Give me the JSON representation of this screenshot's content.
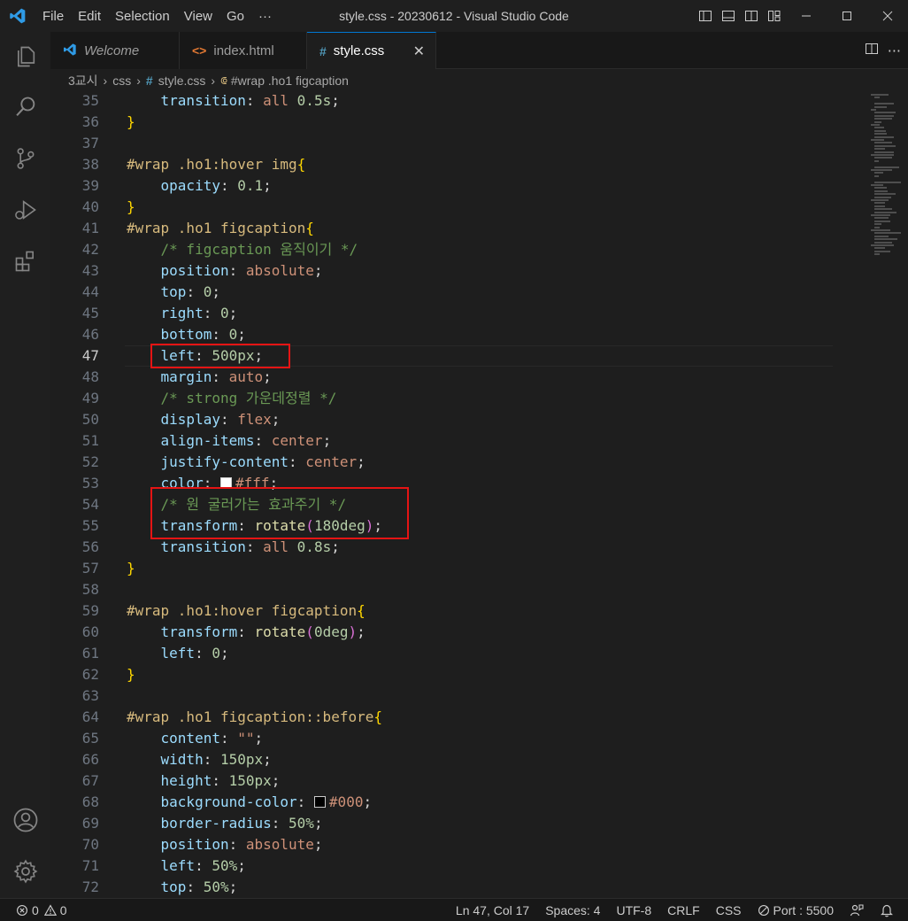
{
  "menu": [
    "File",
    "Edit",
    "Selection",
    "View",
    "Go",
    "···"
  ],
  "window_title": "style.css - 20230612 - Visual Studio Code",
  "tabs": [
    {
      "label": "Welcome",
      "icon": "vscode-icon"
    },
    {
      "label": "index.html",
      "icon": "html-icon"
    },
    {
      "label": "style.css",
      "icon": "css-icon",
      "active": true
    }
  ],
  "breadcrumb": [
    "3교시",
    "css",
    "style.css",
    "#wrap .ho1 figcaption"
  ],
  "code_lines": [
    {
      "n": "35",
      "text": "    transition: all 0.5s;"
    },
    {
      "n": "36",
      "text": "}"
    },
    {
      "n": "37",
      "text": ""
    },
    {
      "n": "38",
      "text": "#wrap .ho1:hover img{"
    },
    {
      "n": "39",
      "text": "    opacity: 0.1;"
    },
    {
      "n": "40",
      "text": "}"
    },
    {
      "n": "41",
      "text": "#wrap .ho1 figcaption{"
    },
    {
      "n": "42",
      "text": "    /* figcaption 움직이기 */"
    },
    {
      "n": "43",
      "text": "    position: absolute;"
    },
    {
      "n": "44",
      "text": "    top: 0;"
    },
    {
      "n": "45",
      "text": "    right: 0;"
    },
    {
      "n": "46",
      "text": "    bottom: 0;"
    },
    {
      "n": "47",
      "text": "    left: 500px;"
    },
    {
      "n": "48",
      "text": "    margin: auto;"
    },
    {
      "n": "49",
      "text": "    /* strong 가운데정렬 */"
    },
    {
      "n": "50",
      "text": "    display: flex;"
    },
    {
      "n": "51",
      "text": "    align-items: center;"
    },
    {
      "n": "52",
      "text": "    justify-content: center;"
    },
    {
      "n": "53",
      "text": "    color: #fff;"
    },
    {
      "n": "54",
      "text": "    /* 원 굴러가는 효과주기 */"
    },
    {
      "n": "55",
      "text": "    transform: rotate(180deg);"
    },
    {
      "n": "56",
      "text": "    transition: all 0.8s;"
    },
    {
      "n": "57",
      "text": "}"
    },
    {
      "n": "58",
      "text": ""
    },
    {
      "n": "59",
      "text": "#wrap .ho1:hover figcaption{"
    },
    {
      "n": "60",
      "text": "    transform: rotate(0deg);"
    },
    {
      "n": "61",
      "text": "    left: 0;"
    },
    {
      "n": "62",
      "text": "}"
    },
    {
      "n": "63",
      "text": ""
    },
    {
      "n": "64",
      "text": "#wrap .ho1 figcaption::before{"
    },
    {
      "n": "65",
      "text": "    content: \"\";"
    },
    {
      "n": "66",
      "text": "    width: 150px;"
    },
    {
      "n": "67",
      "text": "    height: 150px;"
    },
    {
      "n": "68",
      "text": "    background-color: #000;"
    },
    {
      "n": "69",
      "text": "    border-radius: 50%;"
    },
    {
      "n": "70",
      "text": "    position: absolute;"
    },
    {
      "n": "71",
      "text": "    left: 50%;"
    },
    {
      "n": "72",
      "text": "    top: 50%;"
    }
  ],
  "current_line": "47",
  "status": {
    "problems_errors": "0",
    "problems_warnings": "0",
    "cursor": "Ln 47, Col 17",
    "spaces": "Spaces: 4",
    "encoding": "UTF-8",
    "eol": "CRLF",
    "language": "CSS",
    "port": "Port : 5500"
  },
  "colors": {
    "accent": "#0078d4",
    "highlight_box": "#e51414",
    "selector": "#d7ba7d",
    "property": "#9cdcfe",
    "value": "#ce9178",
    "number": "#b5cea8",
    "comment": "#6a9955"
  }
}
